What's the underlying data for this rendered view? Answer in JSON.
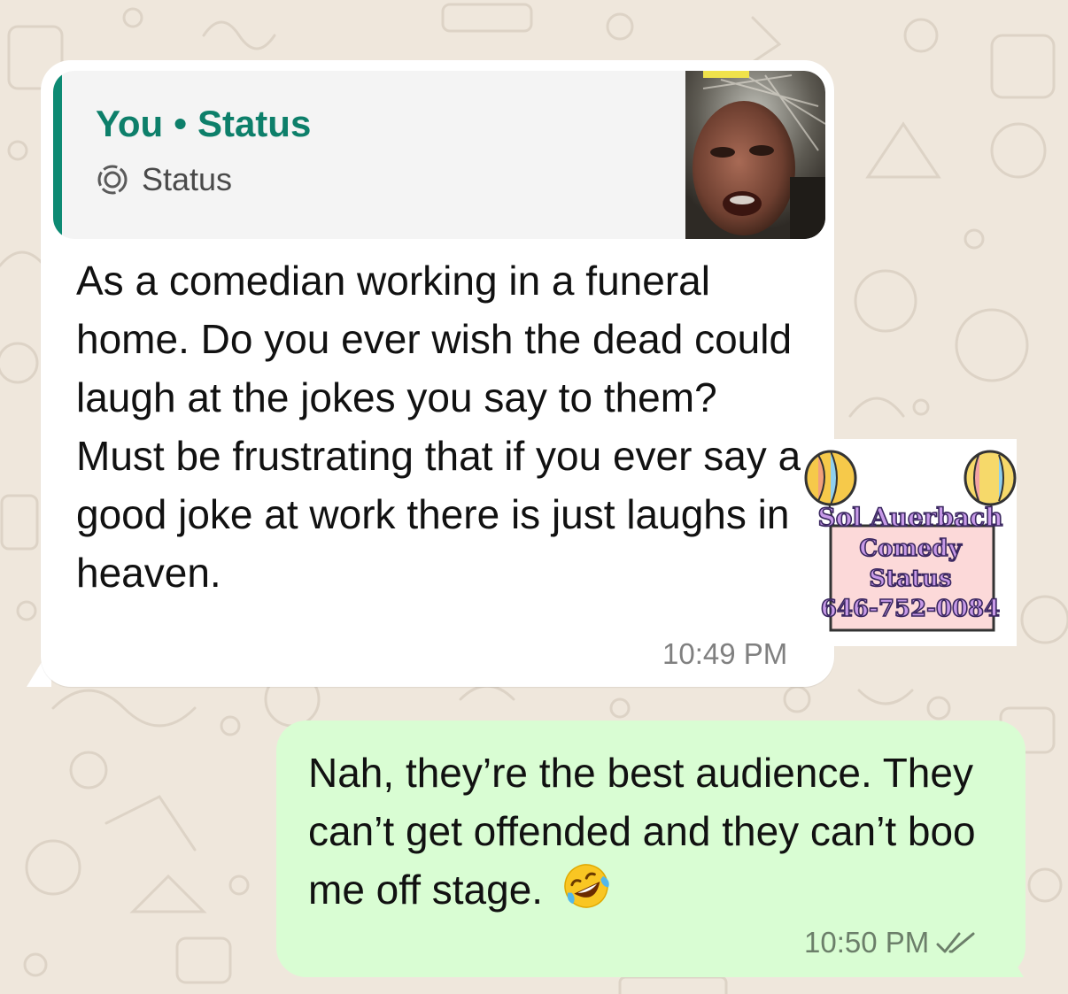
{
  "chat": {
    "incoming": {
      "quote": {
        "author": "You",
        "separator": "•",
        "title": "Status",
        "subtitle": "Status",
        "status_icon": "status-ring-icon",
        "thumbnail_icon": "video-thumbnail-selfie"
      },
      "lines": [
        "As a comedian working in a funeral home. Do you ever wish the dead could laugh at the jokes you say to them?",
        "Must be frustrating that if you ever say a good joke at work there is just laughs in heaven."
      ],
      "time": "10:49 PM"
    },
    "sticker": {
      "line1": "Sol Auerbach",
      "line2": "Comedy",
      "line3": "Status",
      "line4": "646-752-0084",
      "icon": "balloons-sign-sticker"
    },
    "outgoing": {
      "text": "Nah, they’re the best audience. They can’t get offended and they can’t boo me off stage.",
      "emoji": "rolling-on-floor-laughing-emoji",
      "time": "10:50 PM",
      "status_icon": "double-check-icon"
    }
  },
  "colors": {
    "wallpaper": "#efe7dc",
    "incoming_bubble": "#ffffff",
    "outgoing_bubble": "#d9fdd3",
    "accent": "#0d8a73"
  }
}
